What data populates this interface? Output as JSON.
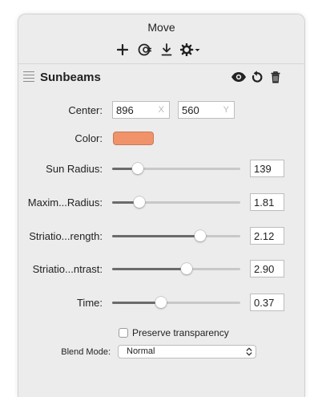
{
  "window": {
    "title": "Move"
  },
  "toolbar": {
    "add_icon": "plus-icon",
    "effects_icon": "effects-icon",
    "download_icon": "download-icon",
    "settings_icon": "gear-dropdown-icon"
  },
  "filter": {
    "name": "Sunbeams",
    "visibility_icon": "eye-icon",
    "reset_icon": "reset-icon",
    "delete_icon": "trash-icon"
  },
  "center": {
    "label": "Center:",
    "x_value": "896",
    "x_suffix": "X",
    "y_value": "560",
    "y_suffix": "Y"
  },
  "color": {
    "label": "Color:",
    "value": "#f0936a"
  },
  "params": [
    {
      "label": "Sun Radius:",
      "value": "139",
      "fraction": 0.2
    },
    {
      "label": "Maxim...Radius:",
      "value": "1.81",
      "fraction": 0.21
    },
    {
      "label": "Striatio...rength:",
      "value": "2.12",
      "fraction": 0.69
    },
    {
      "label": "Striatio...ntrast:",
      "value": "2.90",
      "fraction": 0.58
    },
    {
      "label": "Time:",
      "value": "0.37",
      "fraction": 0.38
    }
  ],
  "preserve_transparency": {
    "label": "Preserve transparency",
    "checked": false
  },
  "blend_mode": {
    "label": "Blend Mode:",
    "value": "Normal"
  }
}
